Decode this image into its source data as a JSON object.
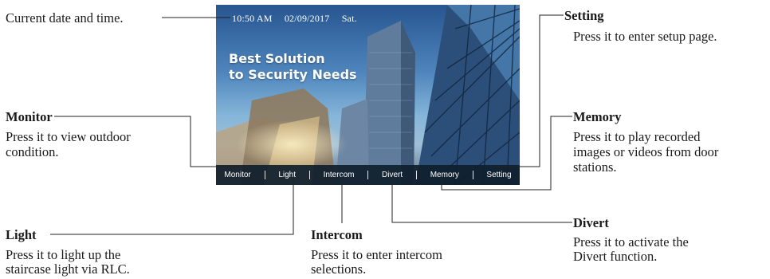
{
  "screen": {
    "time": "10:50 AM",
    "date": "02/09/2017",
    "day": "Sat.",
    "slogan_line1": "Best Solution",
    "slogan_line2": "to Security Needs",
    "menu": [
      "Monitor",
      "Light",
      "Intercom",
      "Divert",
      "Memory",
      "Setting"
    ]
  },
  "callouts": {
    "datetime": "Current date and time.",
    "monitor": {
      "title": "Monitor",
      "desc_line1": "Press it to view outdoor",
      "desc_line2": "condition."
    },
    "light": {
      "title": "Light",
      "desc_line1": "Press it to light up the",
      "desc_line2": "staircase light via RLC."
    },
    "intercom": {
      "title": "Intercom",
      "desc_line1": "Press it to enter intercom",
      "desc_line2": "selections."
    },
    "divert": {
      "title": "Divert",
      "desc_line1": "Press it to activate the",
      "desc_line2": "Divert function."
    },
    "memory": {
      "title": "Memory",
      "desc_line1": "Press it to play recorded",
      "desc_line2": "images or videos from door",
      "desc_line3": "stations."
    },
    "setting": {
      "title": "Setting",
      "desc": "Press it to enter setup page."
    }
  }
}
